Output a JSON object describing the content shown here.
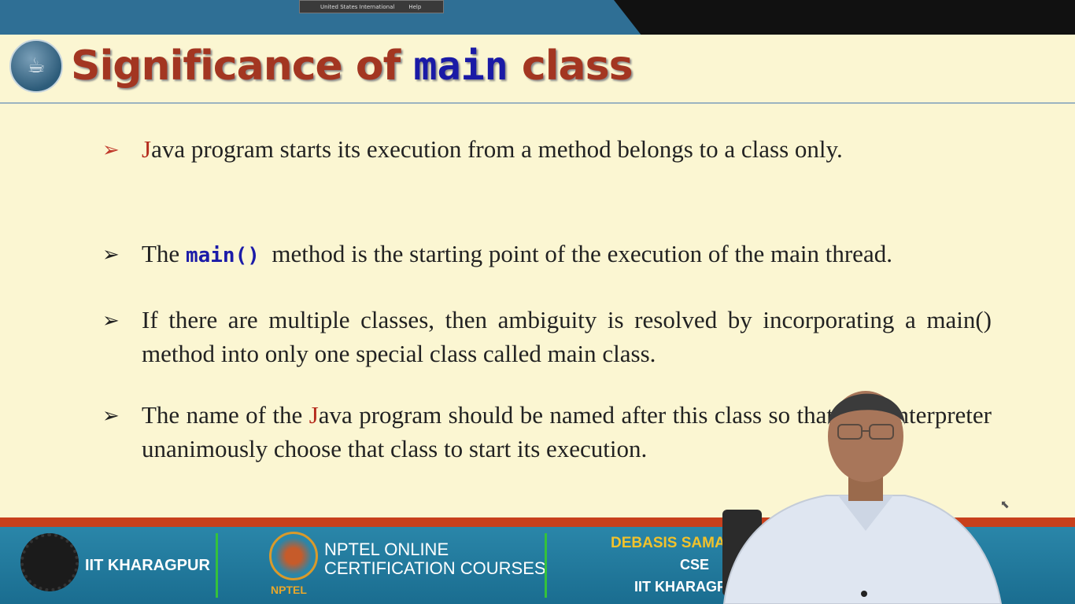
{
  "top_bar": {
    "language_text": "United States International",
    "help_text": "Help"
  },
  "slide": {
    "title_part1": "Significance of",
    "title_code": "main",
    "title_part2": "class",
    "bullets": [
      {
        "seg1": "J",
        "seg2": "ava program starts its execution from a method belongs to a class only."
      },
      {
        "seg1": "The ",
        "code": "main()",
        "seg2": "  method is the starting point of the execution of the main thread."
      },
      {
        "text": "If there are multiple classes, then ambiguity is resolved by incorporating a main() method into only one special class called main class."
      },
      {
        "seg1": "The name of the ",
        "j1": "J",
        "seg2": "ava program should be named after this class so that ",
        "j2": "J",
        "seg3": "ava interpreter unanimously choose that class to start its execution."
      }
    ]
  },
  "footer": {
    "institute": "IIT KHARAGPUR",
    "nptel_line1": "NPTEL ONLINE",
    "nptel_line2": "CERTIFICATION COURSES",
    "nptel_tag": "NPTEL",
    "professor": "DEBASIS SAMANTA",
    "department": "CSE",
    "institution": "IIT KHARAGPUR"
  },
  "colors": {
    "slide_bg": "#fbf6d2",
    "title_red": "#a33621",
    "code_blue": "#1a1aa6",
    "footer_blue": "#1a6d90",
    "accent_line": "#c8401c"
  }
}
